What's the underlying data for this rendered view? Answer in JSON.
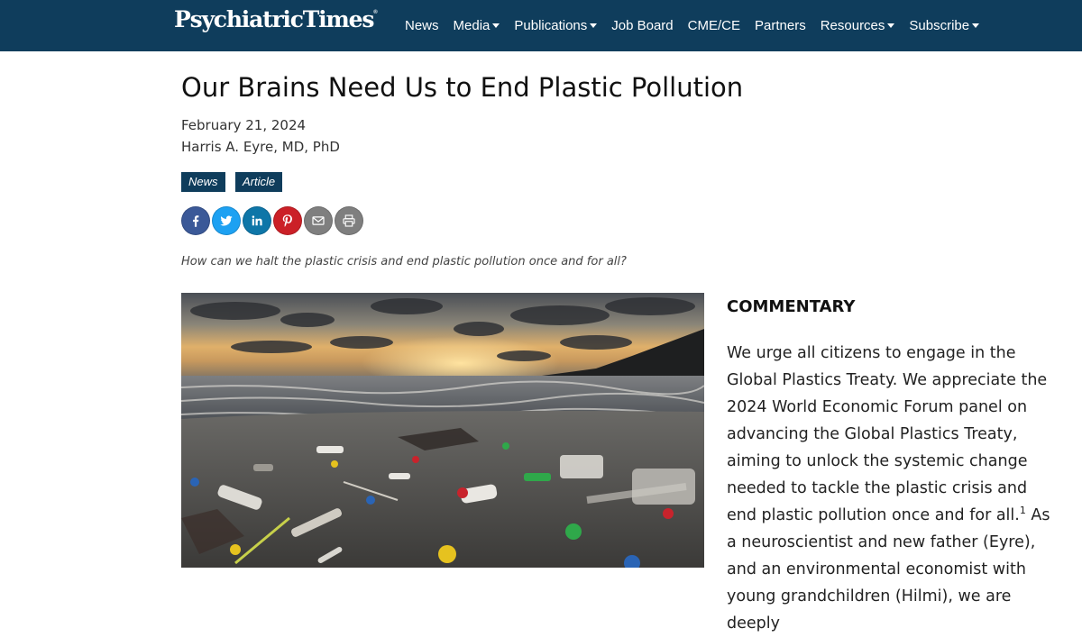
{
  "site": {
    "logo_text": "PsychiatricTimes",
    "logo_mark": "®"
  },
  "nav": {
    "items": [
      {
        "label": "News",
        "has_dropdown": false
      },
      {
        "label": "Media",
        "has_dropdown": true
      },
      {
        "label": "Publications",
        "has_dropdown": true
      },
      {
        "label": "Job Board",
        "has_dropdown": false
      },
      {
        "label": "CME/CE",
        "has_dropdown": false
      },
      {
        "label": "Partners",
        "has_dropdown": false
      },
      {
        "label": "Resources",
        "has_dropdown": true
      },
      {
        "label": "Subscribe",
        "has_dropdown": true
      }
    ]
  },
  "article": {
    "title": "Our Brains Need Us to End Plastic Pollution",
    "date": "February 21, 2024",
    "author": "Harris A. Eyre, MD, PhD",
    "tags": [
      "News",
      "Article"
    ],
    "subtitle": "How can we halt the plastic crisis and end plastic pollution once and for all?",
    "section_label": "COMMENTARY",
    "body_part1": "We urge all citizens to engage in the Global Plastics Treaty. We appreciate the 2024 World Economic Forum panel on advancing the Global Plastics Treaty, aiming to unlock the systemic change needed to tackle the plastic crisis and end plastic pollution once and for all.",
    "footnote_ref": "1",
    "body_part2": " As a neuroscientist and new father (Eyre), and an environmental economist with young grandchildren (Hilmi), we are deeply"
  },
  "share": {
    "buttons": [
      {
        "icon": "facebook-icon",
        "color": "#3b5998"
      },
      {
        "icon": "twitter-icon",
        "color": "#1da1f2"
      },
      {
        "icon": "linkedin-icon",
        "color": "#0e76a8"
      },
      {
        "icon": "pinterest-icon",
        "color": "#cb2027"
      },
      {
        "icon": "email-icon",
        "color": "#7f7f7f"
      },
      {
        "icon": "print-icon",
        "color": "#7f7f7f"
      }
    ]
  },
  "colors": {
    "header_bg": "#0f3d5c",
    "tag_bg": "#0f3d5c"
  }
}
